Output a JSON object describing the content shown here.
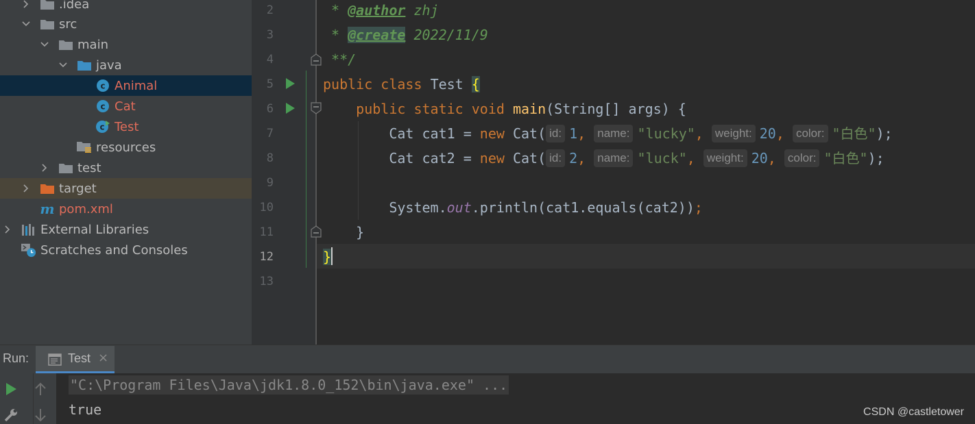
{
  "project_tree": {
    "items": [
      {
        "label": ".idea",
        "icon": "folder-icon",
        "expanded": false
      },
      {
        "label": "src",
        "icon": "folder-icon",
        "expanded": true
      },
      {
        "label": "main",
        "icon": "folder-icon",
        "expanded": true
      },
      {
        "label": "java",
        "icon": "source-folder-icon",
        "expanded": true
      },
      {
        "label": "Animal",
        "icon": "java-class-icon",
        "selected": true
      },
      {
        "label": "Cat",
        "icon": "java-class-icon"
      },
      {
        "label": "Test",
        "icon": "java-class-runnable-icon"
      },
      {
        "label": "resources",
        "icon": "resources-folder-icon"
      },
      {
        "label": "test",
        "icon": "folder-icon",
        "expanded": false
      },
      {
        "label": "target",
        "icon": "excluded-folder-icon",
        "expanded": false
      },
      {
        "label": "pom.xml",
        "icon": "maven-icon"
      },
      {
        "label": "External Libraries",
        "icon": "libraries-icon",
        "expanded": false
      },
      {
        "label": "Scratches and Consoles",
        "icon": "scratches-icon"
      }
    ]
  },
  "editor": {
    "line_numbers": [
      "2",
      "3",
      "4",
      "5",
      "6",
      "7",
      "8",
      "9",
      "10",
      "11",
      "12",
      "13"
    ],
    "current_line": "12",
    "lines": {
      "l2_star": " * ",
      "l2_tag": "@author",
      "l2_text": " zhj",
      "l3_star": " * ",
      "l3_tag": "@create",
      "l3_text": " 2022/11/9",
      "l4": " **/",
      "l5_kw1": "public",
      "l5_kw2": "class",
      "l5_name": "Test",
      "l5_brace": "{",
      "l6_kw": "public static void",
      "l6_fn": "main",
      "l6_rest": "(String[] args) {",
      "l7_decl": "Cat cat1 = ",
      "l7_new": "new",
      "l7_call": " Cat(",
      "l7_id": "1",
      "l7_name": "\"lucky\"",
      "l7_weight": "20",
      "l7_color": "\"白色\"",
      "l7_end": ");",
      "l8_decl": "Cat cat2 = ",
      "l8_new": "new",
      "l8_call": " Cat(",
      "l8_id": "2",
      "l8_name": "\"luck\"",
      "l8_weight": "20",
      "l8_color": "\"白色\"",
      "l8_end": ");",
      "l10_sys": "System.",
      "l10_out": "out",
      "l10_rest": ".println(cat1.equals(cat2))",
      "l10_semi": ";",
      "l11": "}",
      "l12": "}"
    },
    "hints": {
      "id": "id:",
      "name": "name:",
      "weight": "weight:",
      "color": "color:"
    }
  },
  "run_panel": {
    "label": "Run:",
    "tab_label": "Test",
    "tab_close": "×",
    "console_cmd": "\"C:\\Program Files\\Java\\jdk1.8.0_152\\bin\\java.exe\" ...",
    "console_output": "true"
  },
  "watermark": "CSDN @castletower",
  "colors": {
    "sidebar_bg": "#3c3f41",
    "editor_bg": "#2b2b2b",
    "selection": "#0d293e",
    "keyword": "#cc7832",
    "number": "#6897bb",
    "string": "#6a8759",
    "run_green": "#499c54"
  }
}
